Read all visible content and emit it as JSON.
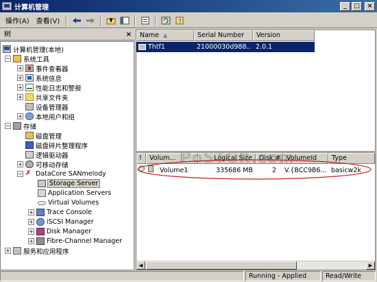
{
  "window": {
    "title": "计算机管理"
  },
  "menu": {
    "action": "操作(A)",
    "view": "查看(V)"
  },
  "tree_pane": {
    "header": "树"
  },
  "tree": [
    {
      "label": "计算机管理(本地)"
    },
    {
      "label": "系统工具"
    },
    {
      "label": "事件查看器"
    },
    {
      "label": "系统信息"
    },
    {
      "label": "性能日志和警报"
    },
    {
      "label": "共享文件夹"
    },
    {
      "label": "设备管理器"
    },
    {
      "label": "本地用户和组"
    },
    {
      "label": "存储"
    },
    {
      "label": "磁盘管理"
    },
    {
      "label": "磁盘碎片整理程序"
    },
    {
      "label": "逻辑驱动器"
    },
    {
      "label": "可移动存储"
    },
    {
      "label": "DataCore SANmelody"
    },
    {
      "label": "Storage Server"
    },
    {
      "label": "Application Servers"
    },
    {
      "label": "Virtual Volumes"
    },
    {
      "label": "Trace Console"
    },
    {
      "label": "iSCSI Manager"
    },
    {
      "label": "Disk Manager"
    },
    {
      "label": "Fibre-Channel Manager"
    },
    {
      "label": "服务和应用程序"
    }
  ],
  "upper_table": {
    "columns": [
      "Name",
      "Serial Number",
      "Version"
    ],
    "rows": [
      {
        "name": "Thtf1",
        "serial": "21000030d988...",
        "version": "2.0.1"
      }
    ]
  },
  "lower_table": {
    "columns": [
      "Volum...",
      "Logical Size",
      "Disk #",
      "VolumeId",
      "Type"
    ],
    "rows": [
      {
        "volume": "Volume1",
        "size": "335686 MB",
        "disk": "2",
        "volume_id": "V.{BCC9B6...",
        "type": "basicw2k"
      }
    ]
  },
  "watermark": "PoSTGR.com",
  "status": {
    "panel1": "",
    "panel2": "Running - Applied",
    "panel3": "Read/Write"
  },
  "colors": {
    "title_bar": "#0a246a",
    "selection": "#0a246a",
    "annotation_ellipse": "#c02020"
  }
}
